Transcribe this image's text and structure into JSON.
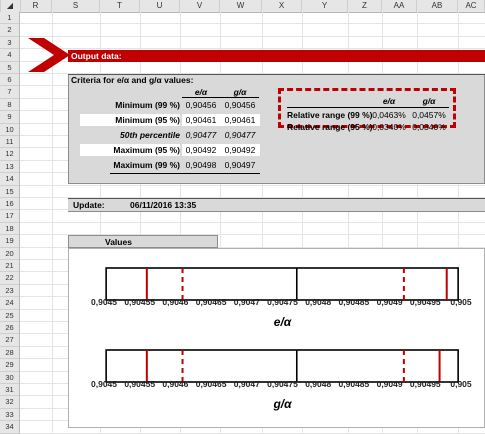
{
  "columns": [
    "R",
    "S",
    "T",
    "U",
    "V",
    "W",
    "X",
    "Y",
    "Z",
    "AA",
    "AB",
    "AC"
  ],
  "rows": [
    "1",
    "2",
    "3",
    "4",
    "5",
    "6",
    "7",
    "8",
    "9",
    "10",
    "11",
    "12",
    "13",
    "14",
    "15",
    "16",
    "17",
    "18",
    "19",
    "20",
    "21",
    "22",
    "23",
    "24",
    "25",
    "26",
    "27",
    "28",
    "29",
    "30",
    "31",
    "32",
    "33",
    "34"
  ],
  "output_title": "Output data:",
  "criteria_title": "Criteria for e/α and g/α values:",
  "table": {
    "col_e": "e/α",
    "col_g": "g/α",
    "rows": [
      {
        "label": "Minimum (99 %)",
        "e": "0,90456",
        "g": "0,90456"
      },
      {
        "label": "Minimum (95 %)",
        "e": "0,90461",
        "g": "0,90461"
      },
      {
        "label": "50th percentile",
        "e": "0,90477",
        "g": "0,90477"
      },
      {
        "label": "Maximum (95 %)",
        "e": "0,90492",
        "g": "0,90492"
      },
      {
        "label": "Maximum (99 %)",
        "e": "0,90498",
        "g": "0,90497"
      }
    ]
  },
  "range_table": {
    "col_e": "e/α",
    "col_g": "g/α",
    "rows": [
      {
        "label": "Relative range (99 %)",
        "e": "0,0463%",
        "g": "0,0457%"
      },
      {
        "label": "Relative range (95 %)",
        "e": "0,0340%",
        "g": "0,0340%"
      }
    ]
  },
  "update_label": "Update:",
  "update_value": "06/11/2016 13:35",
  "values_label": "Values",
  "colors": {
    "banner": "#c00000",
    "panel": "#d9d9d9",
    "marker": "#c00000"
  },
  "chart_data": [
    {
      "type": "box-range",
      "xlabel": "e/α",
      "xlim": [
        0.9045,
        0.905
      ],
      "ticks": [
        "0,9045",
        "0,90455",
        "0,9046",
        "0,90465",
        "0,9047",
        "0,90475",
        "0,9048",
        "0,90485",
        "0,9049",
        "0,90495",
        "0,905"
      ],
      "min99": 0.90456,
      "min95": 0.90461,
      "median": 0.90477,
      "max95": 0.90492,
      "max99": 0.90498
    },
    {
      "type": "box-range",
      "xlabel": "g/α",
      "xlim": [
        0.9045,
        0.905
      ],
      "ticks": [
        "0,9045",
        "0,90455",
        "0,9046",
        "0,90465",
        "0,9047",
        "0,90475",
        "0,9048",
        "0,90485",
        "0,9049",
        "0,90495",
        "0,905"
      ],
      "min99": 0.90456,
      "min95": 0.90461,
      "median": 0.90477,
      "max95": 0.90492,
      "max99": 0.90497
    }
  ]
}
